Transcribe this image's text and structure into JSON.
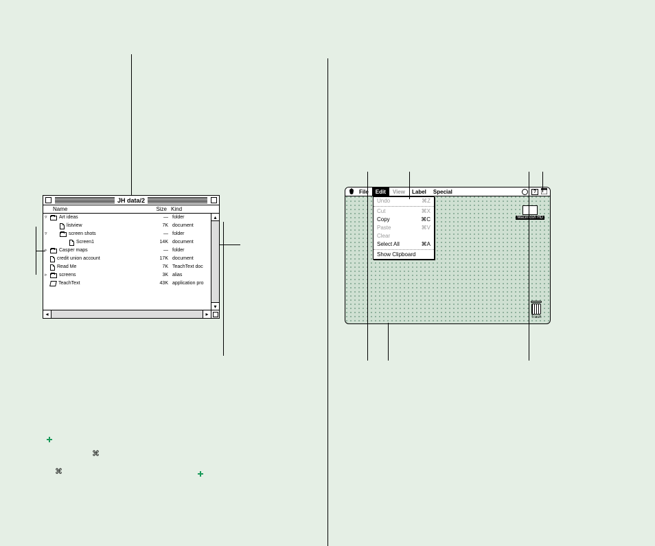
{
  "finder": {
    "title": "JH data/2",
    "columns": {
      "name": "Name",
      "size": "Size",
      "kind": "Kind"
    },
    "rows": [
      {
        "tri": "▿",
        "indent": 0,
        "icon": "folder",
        "name": "Art ideas",
        "size": "—",
        "kind": "folder"
      },
      {
        "tri": "",
        "indent": 1,
        "icon": "doc",
        "name": "listview",
        "size": "7K",
        "kind": "document"
      },
      {
        "tri": "▿",
        "indent": 1,
        "icon": "folder",
        "name": "screen shots",
        "size": "—",
        "kind": "folder"
      },
      {
        "tri": "",
        "indent": 2,
        "icon": "doc",
        "name": "Screen1",
        "size": "14K",
        "kind": "document"
      },
      {
        "tri": "▹",
        "indent": 0,
        "icon": "folder",
        "name": "Casper maps",
        "size": "—",
        "kind": "folder"
      },
      {
        "tri": "",
        "indent": 0,
        "icon": "doc",
        "name": "credit union account",
        "size": "17K",
        "kind": "document"
      },
      {
        "tri": "",
        "indent": 0,
        "icon": "doc",
        "name": "Read Me",
        "size": "7K",
        "kind": "TeachText doc"
      },
      {
        "tri": "▹",
        "indent": 0,
        "icon": "folder",
        "name": "screens",
        "size": "3K",
        "kind": "alias"
      },
      {
        "tri": "",
        "indent": 0,
        "icon": "app",
        "name": "TeachText",
        "size": "43K",
        "kind": "application pro"
      }
    ]
  },
  "desktop": {
    "menus": {
      "file": "File",
      "edit": "Edit",
      "view": "View",
      "label": "Label",
      "special": "Special"
    },
    "edit_menu": [
      {
        "label": "Undo",
        "short": "⌘Z",
        "dim": true
      },
      {
        "sep": true
      },
      {
        "label": "Cut",
        "short": "⌘X",
        "dim": true
      },
      {
        "label": "Copy",
        "short": "⌘C",
        "dim": false
      },
      {
        "label": "Paste",
        "short": "⌘V",
        "dim": true
      },
      {
        "label": "Clear",
        "short": "",
        "dim": true
      },
      {
        "label": "Select All",
        "short": "⌘A",
        "dim": false
      },
      {
        "sep": true
      },
      {
        "label": "Show Clipboard",
        "short": "",
        "dim": false
      }
    ],
    "disk_label": "Macintosh HD",
    "trash_label": "Trash",
    "help_glyph": "?"
  }
}
